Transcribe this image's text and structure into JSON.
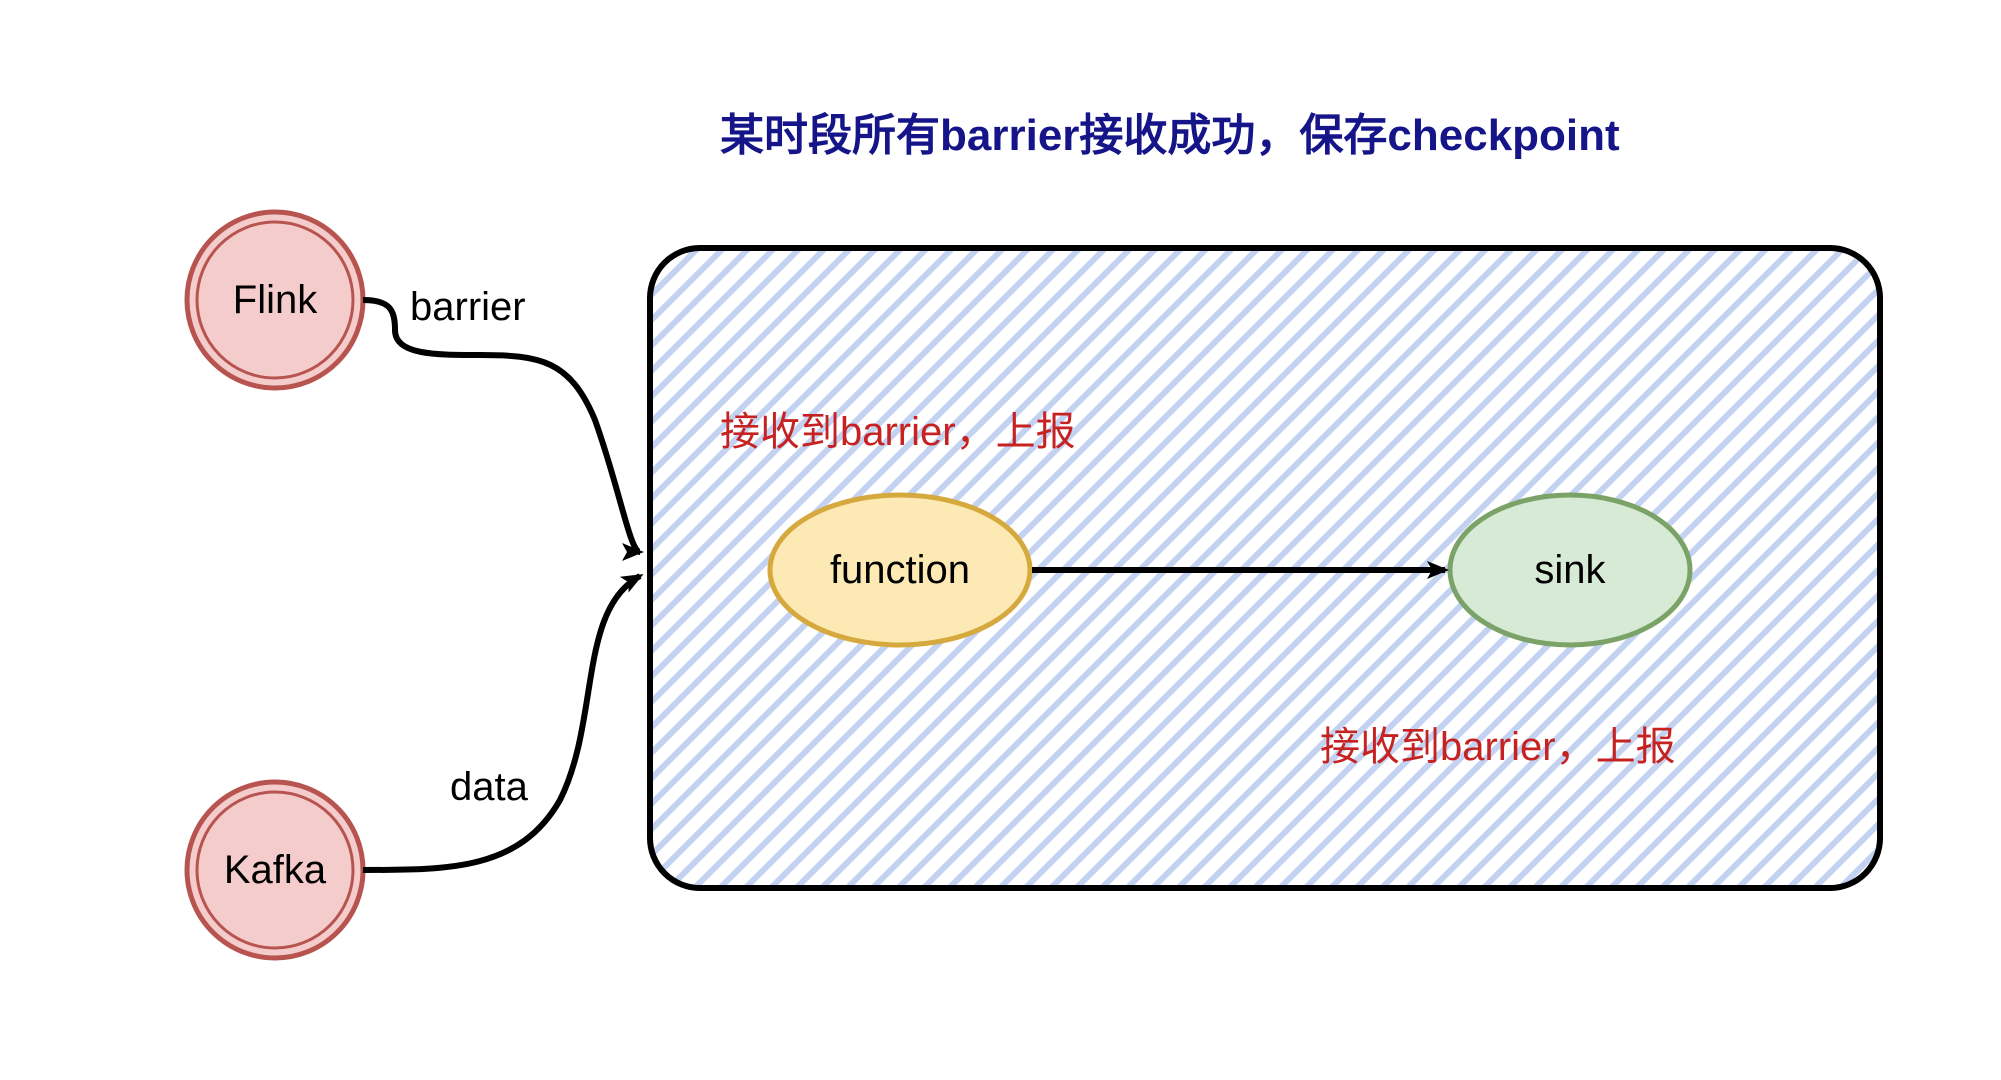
{
  "diagram": {
    "title": "某时段所有barrier接收成功，保存checkpoint",
    "nodes": {
      "flink": {
        "label": "Flink"
      },
      "kafka": {
        "label": "Kafka"
      },
      "function": {
        "label": "function",
        "note": "接收到barrier，上报"
      },
      "sink": {
        "label": "sink",
        "note": "接收到barrier，上报"
      }
    },
    "edges": {
      "barrier": {
        "label": "barrier"
      },
      "data": {
        "label": "data"
      }
    },
    "colors": {
      "source_fill": "#f4cccc",
      "source_stroke": "#b85450",
      "function_fill": "#fde9b3",
      "function_stroke": "#d6a93e",
      "sink_fill": "#d6ead5",
      "sink_stroke": "#7ba368",
      "box_hatch": "#c4d2f2",
      "box_stroke": "#000000",
      "title": "#151589",
      "note": "#c62222"
    }
  }
}
